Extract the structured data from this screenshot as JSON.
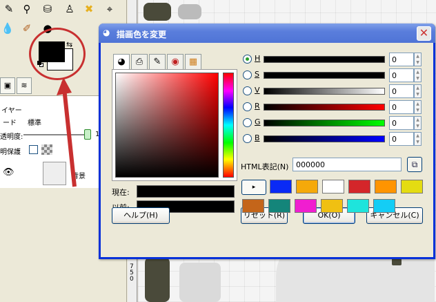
{
  "toolbox": {
    "layer_header": "イヤー",
    "mode_label": "ード",
    "mode_value": "標準",
    "opacity_label": "透明度:",
    "opacity_value_partial": "1",
    "lock_label": "明保護",
    "layer_name": "背景",
    "ruler_label": "750"
  },
  "dialog": {
    "title": "描画色を変更",
    "close_label": "✕",
    "current_label": "現在:",
    "previous_label": "以前:",
    "current_color": "#000000",
    "previous_color": "#000000",
    "channels": [
      {
        "label": "H",
        "value": "0",
        "selected": true
      },
      {
        "label": "S",
        "value": "0",
        "selected": false
      },
      {
        "label": "V",
        "value": "0",
        "selected": false
      },
      {
        "label": "R",
        "value": "0",
        "selected": false
      },
      {
        "label": "G",
        "value": "0",
        "selected": false
      },
      {
        "label": "B",
        "value": "0",
        "selected": false
      }
    ],
    "html_label": "HTML表記(N)",
    "html_value": "000000",
    "history_button": "▸",
    "history_colors": [
      "#0a2af5",
      "#f5a90a",
      "#ffffff",
      "#d4262a",
      "#ff9400",
      "#e4dc12",
      "#c4651a",
      "#14857a",
      "#f01ed0",
      "#f0c012",
      "#1ee4dc",
      "#14cdf5"
    ],
    "buttons": {
      "help": "ヘルプ(H)",
      "reset": "リセット(R)",
      "ok": "OK(O)",
      "cancel": "キャンセル(C)"
    }
  }
}
